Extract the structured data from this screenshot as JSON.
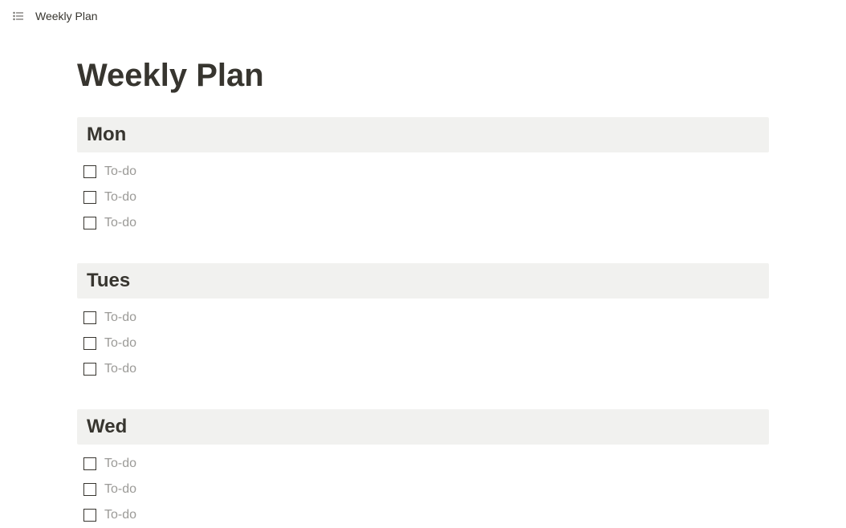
{
  "breadcrumb": "Weekly Plan",
  "pageTitle": "Weekly Plan",
  "sections": [
    {
      "day": "Mon",
      "todos": [
        "To-do",
        "To-do",
        "To-do"
      ]
    },
    {
      "day": "Tues",
      "todos": [
        "To-do",
        "To-do",
        "To-do"
      ]
    },
    {
      "day": "Wed",
      "todos": [
        "To-do",
        "To-do",
        "To-do"
      ]
    }
  ]
}
